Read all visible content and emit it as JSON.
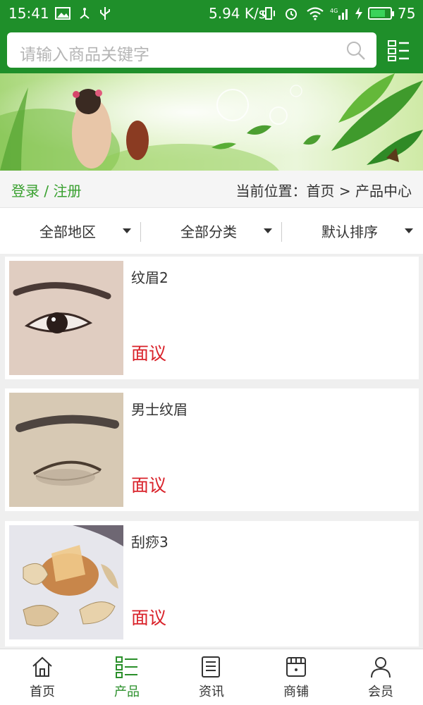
{
  "status_bar": {
    "time": "15:41",
    "speed": "5.94 K/s",
    "battery_percent": "75",
    "battery_level": 0.75
  },
  "search": {
    "placeholder": "请输入商品关键字"
  },
  "location": {
    "login_register": "登录 / 注册",
    "breadcrumb": "当前位置：首页 > 产品中心"
  },
  "filters": [
    {
      "label": "全部地区"
    },
    {
      "label": "全部分类"
    },
    {
      "label": "默认排序"
    }
  ],
  "products": [
    {
      "name": "纹眉2",
      "price": "面议"
    },
    {
      "name": "男士纹眉",
      "price": "面议"
    },
    {
      "name": "刮痧3",
      "price": "面议"
    }
  ],
  "tabs": [
    {
      "label": "首页",
      "icon": "home-icon"
    },
    {
      "label": "产品",
      "icon": "list-icon",
      "active": true
    },
    {
      "label": "资讯",
      "icon": "news-icon"
    },
    {
      "label": "商铺",
      "icon": "store-icon"
    },
    {
      "label": "会员",
      "icon": "user-icon"
    }
  ],
  "colors": {
    "brand_green": "#1f8f2a",
    "active_tab": "#2a8f2a",
    "price_red": "#d9222a",
    "login_green": "#38a02e"
  }
}
